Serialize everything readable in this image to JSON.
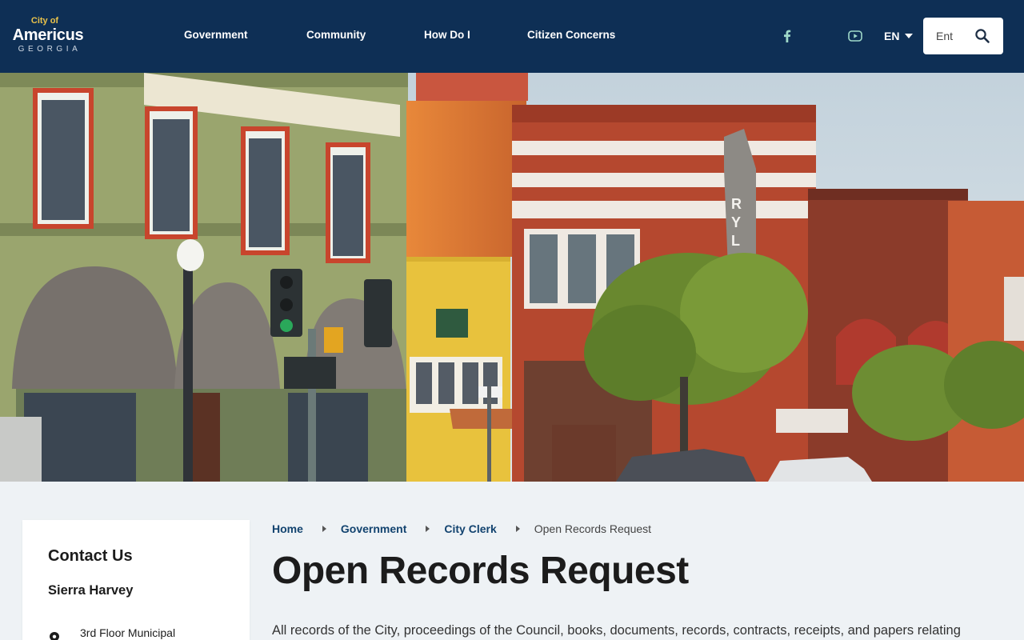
{
  "header": {
    "logo": {
      "city_of": "City of",
      "name": "Americus",
      "state": "GEORGIA"
    },
    "nav": [
      {
        "label": "Government"
      },
      {
        "label": "Community"
      },
      {
        "label": "How Do I"
      },
      {
        "label": "Citizen Concerns"
      }
    ],
    "social": [
      {
        "icon": "facebook-icon",
        "color": "#9fd9c9"
      },
      {
        "icon": "youtube-icon",
        "color": "#9fd9c9"
      }
    ],
    "language": {
      "label": "EN"
    },
    "search": {
      "placeholder": "Ent"
    },
    "colors": {
      "background": "#0e2f55",
      "accent": "#e9c24a"
    }
  },
  "hero": {
    "icon": "downtown-storefronts-photo"
  },
  "sidebar": {
    "heading": "Contact Us",
    "person": "Sierra Harvey",
    "address_line": "3rd Floor Municipal"
  },
  "breadcrumb": {
    "items": [
      "Home",
      "Government",
      "City Clerk"
    ],
    "current": "Open Records Request"
  },
  "page": {
    "title": "Open Records Request",
    "intro": "All records of the City, proceedings of the Council, books, documents, records, contracts, receipts, and papers relating"
  }
}
